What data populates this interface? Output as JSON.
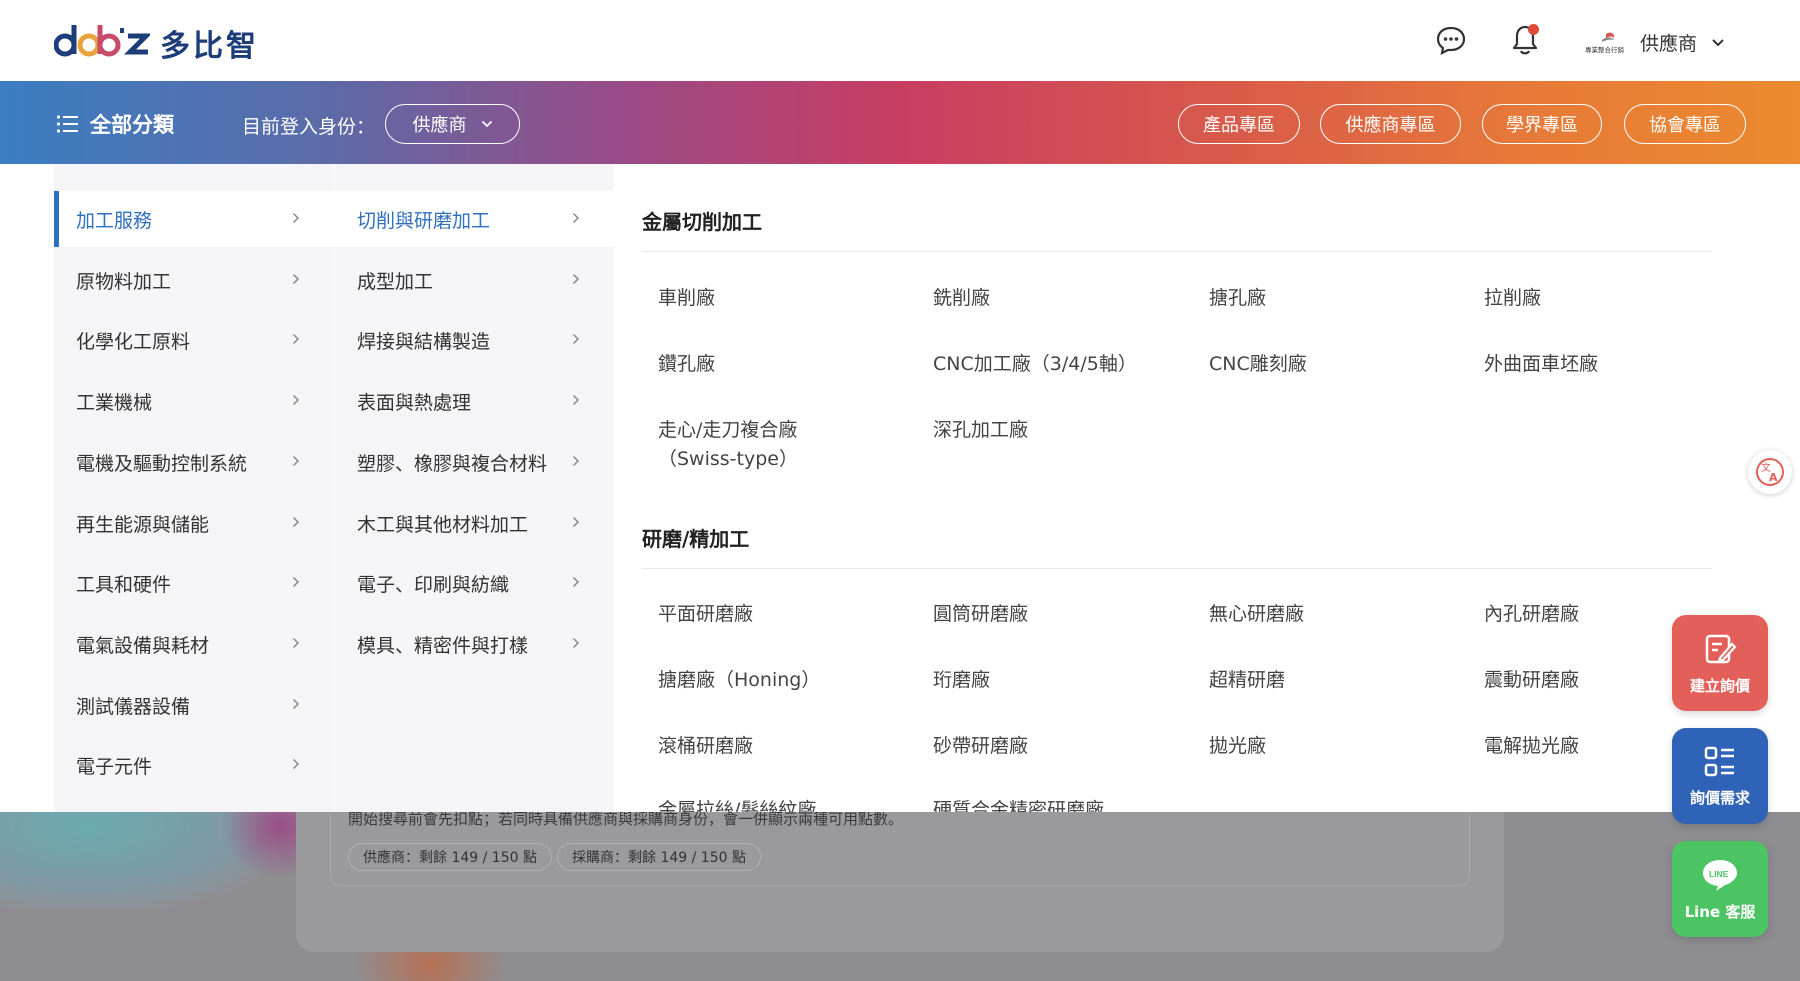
{
  "header": {
    "logo_mark": "dobiz",
    "logo_text": "多比智",
    "user_role": "供應商",
    "user_logo_text": "專業整合行銷"
  },
  "nav": {
    "all_categories": "全部分類",
    "login_as_label": "目前登入身份：",
    "login_as_value": "供應商",
    "zones": [
      "產品專區",
      "供應商專區",
      "學界專區",
      "協會專區"
    ]
  },
  "menu": {
    "level1": [
      "加工服務",
      "原物料加工",
      "化學化工原料",
      "工業機械",
      "電機及驅動控制系統",
      "再生能源與儲能",
      "工具和硬件",
      "電氣設備與耗材",
      "測試儀器設備",
      "電子元件"
    ],
    "level2": [
      "切削與研磨加工",
      "成型加工",
      "焊接與結構製造",
      "表面與熱處理",
      "塑膠、橡膠與複合材料",
      "木工與其他材料加工",
      "電子、印刷與紡織",
      "模具、精密件與打樣"
    ],
    "sections": [
      {
        "title": "金屬切削加工",
        "items": [
          "車削廠",
          "銑削廠",
          "搪孔廠",
          "拉削廠",
          "鑽孔廠",
          "CNC加工廠（3/4/5軸）",
          "CNC雕刻廠",
          "外曲面車坯廠",
          "走心/走刀複合廠（Swiss-type）",
          "深孔加工廠"
        ]
      },
      {
        "title": "研磨/精加工",
        "items": [
          "平面研磨廠",
          "圓筒研磨廠",
          "無心研磨廠",
          "內孔研磨廠",
          "搪磨廠（Honing）",
          "珩磨廠",
          "超精研磨",
          "震動研磨廠",
          "滾桶研磨廠",
          "砂帶研磨廠",
          "拋光廠",
          "電解拋光廠",
          "金屬拉絲/髮絲紋廠",
          "硬質合金精密研磨廠"
        ]
      }
    ]
  },
  "background": {
    "note": "開始搜尋前會先扣點；若同時具備供應商與採購商身份，會一併顯示兩種可用點數。",
    "points": [
      "供應商：剩餘 149 / 150 點",
      "採購商：剩餘 149 / 150 點"
    ]
  },
  "floating": {
    "quote": "建立詢價",
    "needs": "詢價需求",
    "line": "Line 客服",
    "line_badge": "LINE"
  },
  "colors": {
    "accent_blue": "#2f6fc0",
    "quote_red": "#e3605a",
    "needs_blue": "#2f63b8",
    "line_green": "#4cc464"
  }
}
